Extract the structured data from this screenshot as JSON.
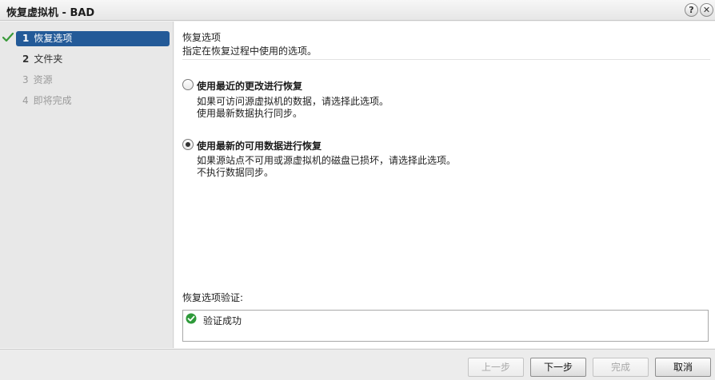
{
  "window": {
    "title": "恢复虚拟机 - BAD",
    "help_glyph": "?",
    "close_glyph": "✕"
  },
  "sidebar": {
    "steps": [
      {
        "num": "1",
        "label": "恢复选项",
        "state": "active"
      },
      {
        "num": "2",
        "label": "文件夹",
        "state": "enabled"
      },
      {
        "num": "3",
        "label": "资源",
        "state": "disabled"
      },
      {
        "num": "4",
        "label": "即将完成",
        "state": "disabled"
      }
    ]
  },
  "header": {
    "title": "恢复选项",
    "description": "指定在恢复过程中使用的选项。"
  },
  "options": [
    {
      "label": "使用最近的更改进行恢复",
      "desc_line1": "如果可访问源虚拟机的数据，请选择此选项。",
      "desc_line2": "使用最新数据执行同步。",
      "selected": false
    },
    {
      "label": "使用最新的可用数据进行恢复",
      "desc_line1": "如果源站点不可用或源虚拟机的磁盘已损坏，请选择此选项。",
      "desc_line2": "不执行数据同步。",
      "selected": true
    }
  ],
  "validation": {
    "label": "恢复选项验证:",
    "status": "验证成功",
    "status_color": "#2e9a3a"
  },
  "footer": {
    "back": "上一步",
    "next": "下一步",
    "finish": "完成",
    "cancel": "取消"
  },
  "colors": {
    "accent": "#235a98"
  }
}
